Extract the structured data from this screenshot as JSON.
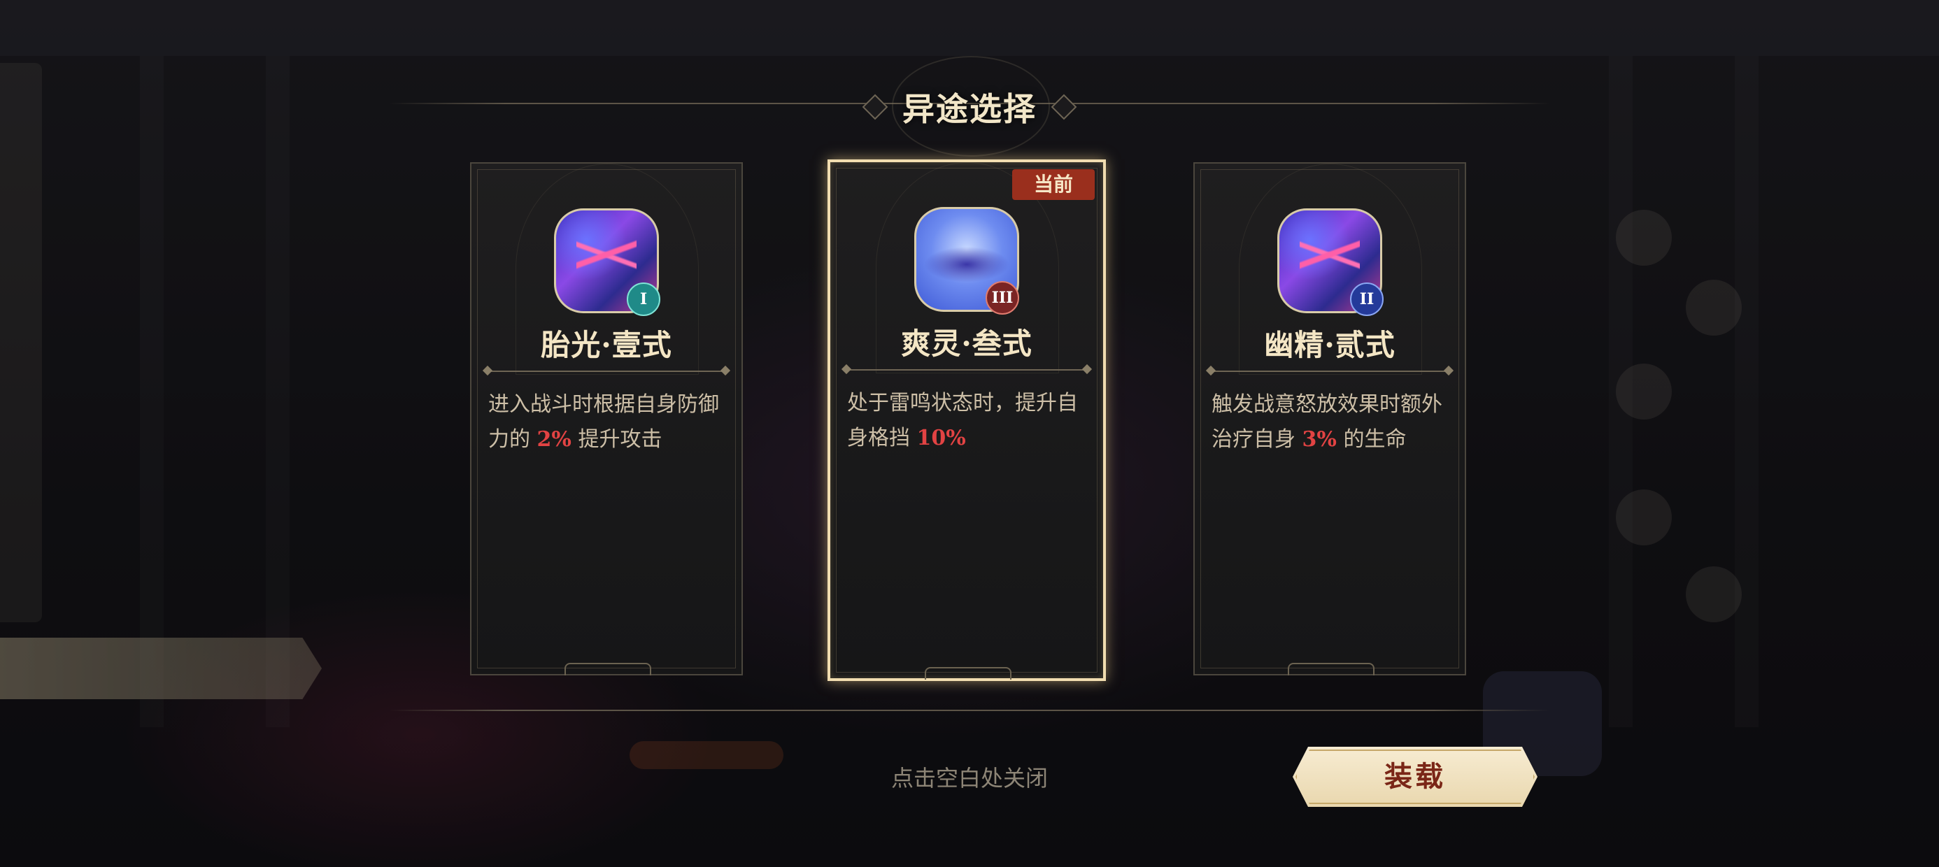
{
  "dialog": {
    "title": "异途选择",
    "close_hint": "点击空白处关闭",
    "equip_label": "装载",
    "current_tag": "当前"
  },
  "cards": [
    {
      "name": "胎光·壹式",
      "tier": "I",
      "desc_before": "进入战斗时根据自身防御力的 ",
      "highlight": "2%",
      "desc_after": " 提升攻击",
      "icon": "lightning-orb-icon",
      "selected": false
    },
    {
      "name": "爽灵·叁式",
      "tier": "III",
      "desc_before": "处于雷鸣状态时，提升自身格挡 ",
      "highlight": "10%",
      "desc_after": "",
      "icon": "storm-cloud-orb-icon",
      "selected": true
    },
    {
      "name": "幽精·贰式",
      "tier": "II",
      "desc_before": "触发战意怒放效果时额外治疗自身 ",
      "highlight": "3%",
      "desc_after": " 的生命",
      "icon": "lightning-orb-icon",
      "selected": false
    }
  ],
  "colors": {
    "highlight": "#e24343",
    "selected_border": "#f1ddb0",
    "tag_bg": "#9a2f1d"
  }
}
